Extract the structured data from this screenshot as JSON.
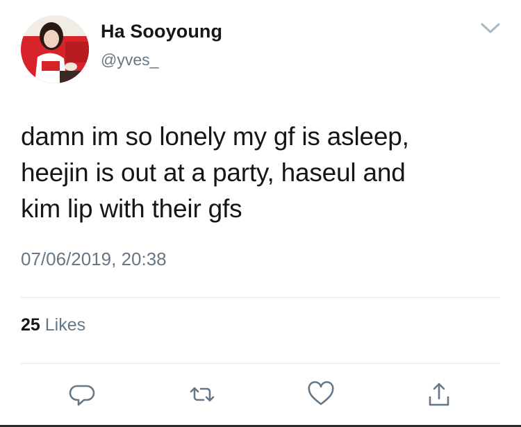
{
  "user": {
    "display_name": "Ha Sooyoung",
    "handle": "@yves_"
  },
  "tweet": {
    "text": "damn im so lonely my gf is asleep,\nheejin is out at a party, haseul and\nkim lip with their gfs",
    "timestamp": "07/06/2019, 20:38"
  },
  "stats": {
    "likes_count": "25",
    "likes_label": "Likes"
  },
  "icons": {
    "menu": "chevron-down-icon",
    "reply": "reply-icon",
    "retweet": "retweet-icon",
    "like": "heart-icon",
    "share": "share-icon"
  },
  "colors": {
    "text_primary": "#14171a",
    "text_secondary": "#657786",
    "divider": "#e1e8ed",
    "icon_gray": "#657786",
    "avatar_red": "#d8232a"
  }
}
